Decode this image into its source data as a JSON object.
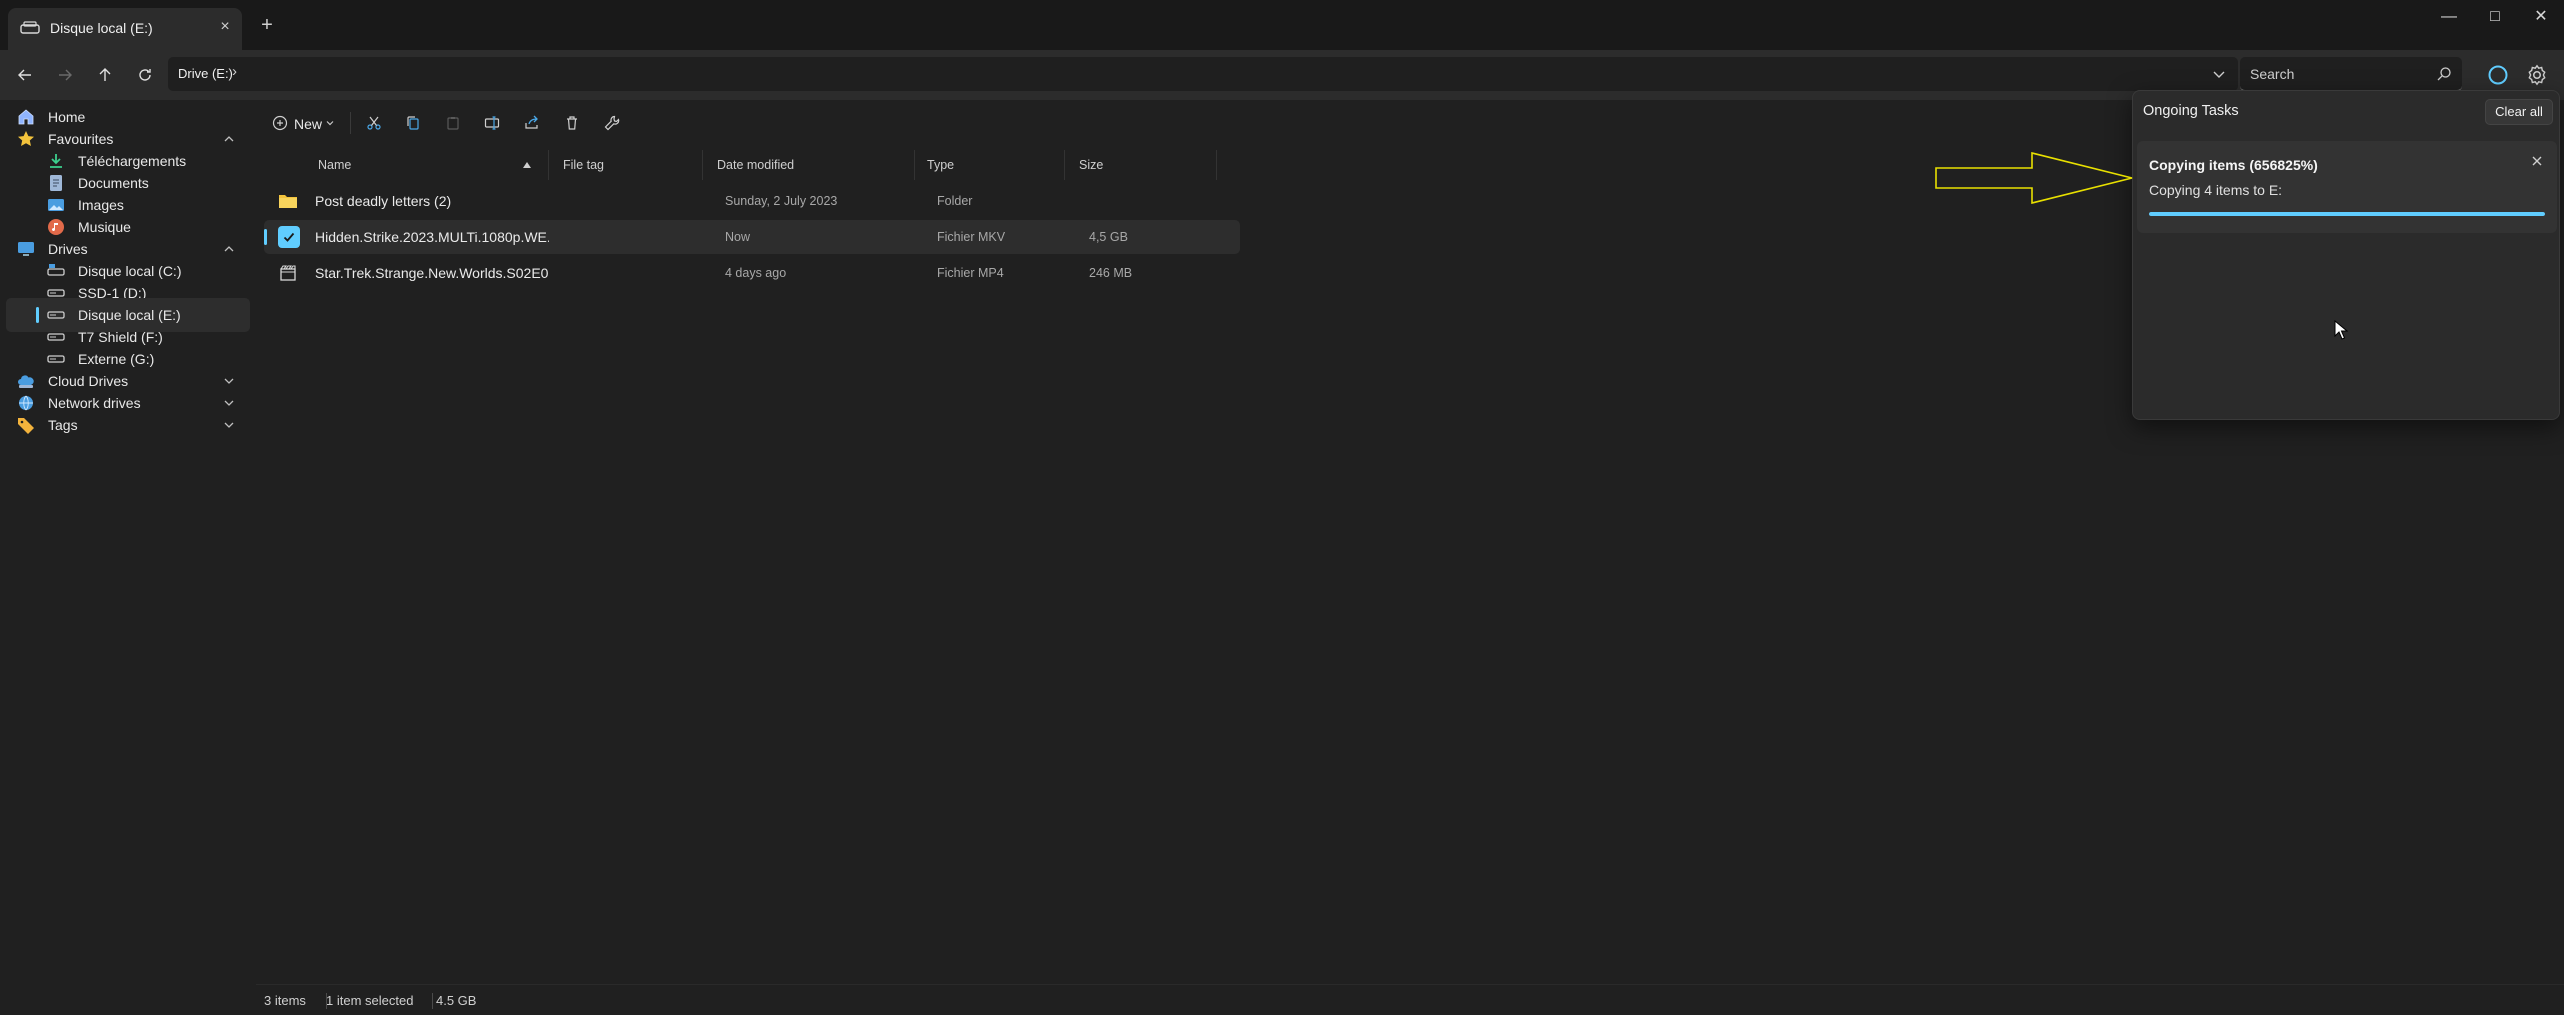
{
  "window": {
    "tab_label": "Disque local (E:)",
    "tab_close_glyph": "×",
    "new_tab_glyph": "+",
    "minimize_glyph": "—",
    "maximize_glyph": "□",
    "close_glyph": "✕"
  },
  "nav": {
    "breadcrumb": "Drive (E:)",
    "breadcrumb_chevron": "›",
    "search_placeholder": "Search"
  },
  "sidebar": {
    "items": [
      {
        "label": "Home",
        "icon": "home-icon"
      },
      {
        "label": "Favourites",
        "icon": "star-icon"
      },
      {
        "label": "Téléchargements",
        "icon": "download-icon"
      },
      {
        "label": "Documents",
        "icon": "document-icon"
      },
      {
        "label": "Images",
        "icon": "image-icon"
      },
      {
        "label": "Musique",
        "icon": "music-icon"
      },
      {
        "label": "Drives",
        "icon": "monitor-icon"
      },
      {
        "label": "Disque local (C:)",
        "icon": "drive-icon"
      },
      {
        "label": "SSD-1 (D:)",
        "icon": "drive-icon"
      },
      {
        "label": "Disque local (E:)",
        "icon": "drive-icon"
      },
      {
        "label": "T7 Shield (F:)",
        "icon": "drive-icon"
      },
      {
        "label": "Externe (G:)",
        "icon": "drive-icon"
      },
      {
        "label": "Cloud Drives",
        "icon": "cloud-drive-icon"
      },
      {
        "label": "Network drives",
        "icon": "network-icon"
      },
      {
        "label": "Tags",
        "icon": "tag-icon"
      }
    ]
  },
  "toolbar": {
    "new_label": "New"
  },
  "file_list": {
    "columns": [
      "Name",
      "File tag",
      "Date modified",
      "Type",
      "Size"
    ],
    "rows": [
      {
        "name": "Post deadly letters (2)",
        "tag": "",
        "date": "Sunday, 2 July 2023",
        "type": "Folder",
        "size": ""
      },
      {
        "name": "Hidden.Strike.2023.MULTi.1080p.WE...",
        "tag": "",
        "date": "Now",
        "type": "Fichier MKV",
        "size": "4,5 GB"
      },
      {
        "name": "Star.Trek.Strange.New.Worlds.S02E0...",
        "tag": "",
        "date": "4 days ago",
        "type": "Fichier MP4",
        "size": "246 MB"
      }
    ]
  },
  "status": {
    "items_count": "3 items",
    "selected": "1 item selected",
    "selected_size": "4.5 GB"
  },
  "tasks": {
    "title": "Ongoing Tasks",
    "clear_all": "Clear all",
    "task_title": "Copying items (656825%)",
    "task_subtitle": "Copying 4 items to E:",
    "progress": 1.0
  },
  "colors": {
    "accent": "#60cdff",
    "folder": "#f3c33c",
    "annotation": "#e8e000"
  }
}
